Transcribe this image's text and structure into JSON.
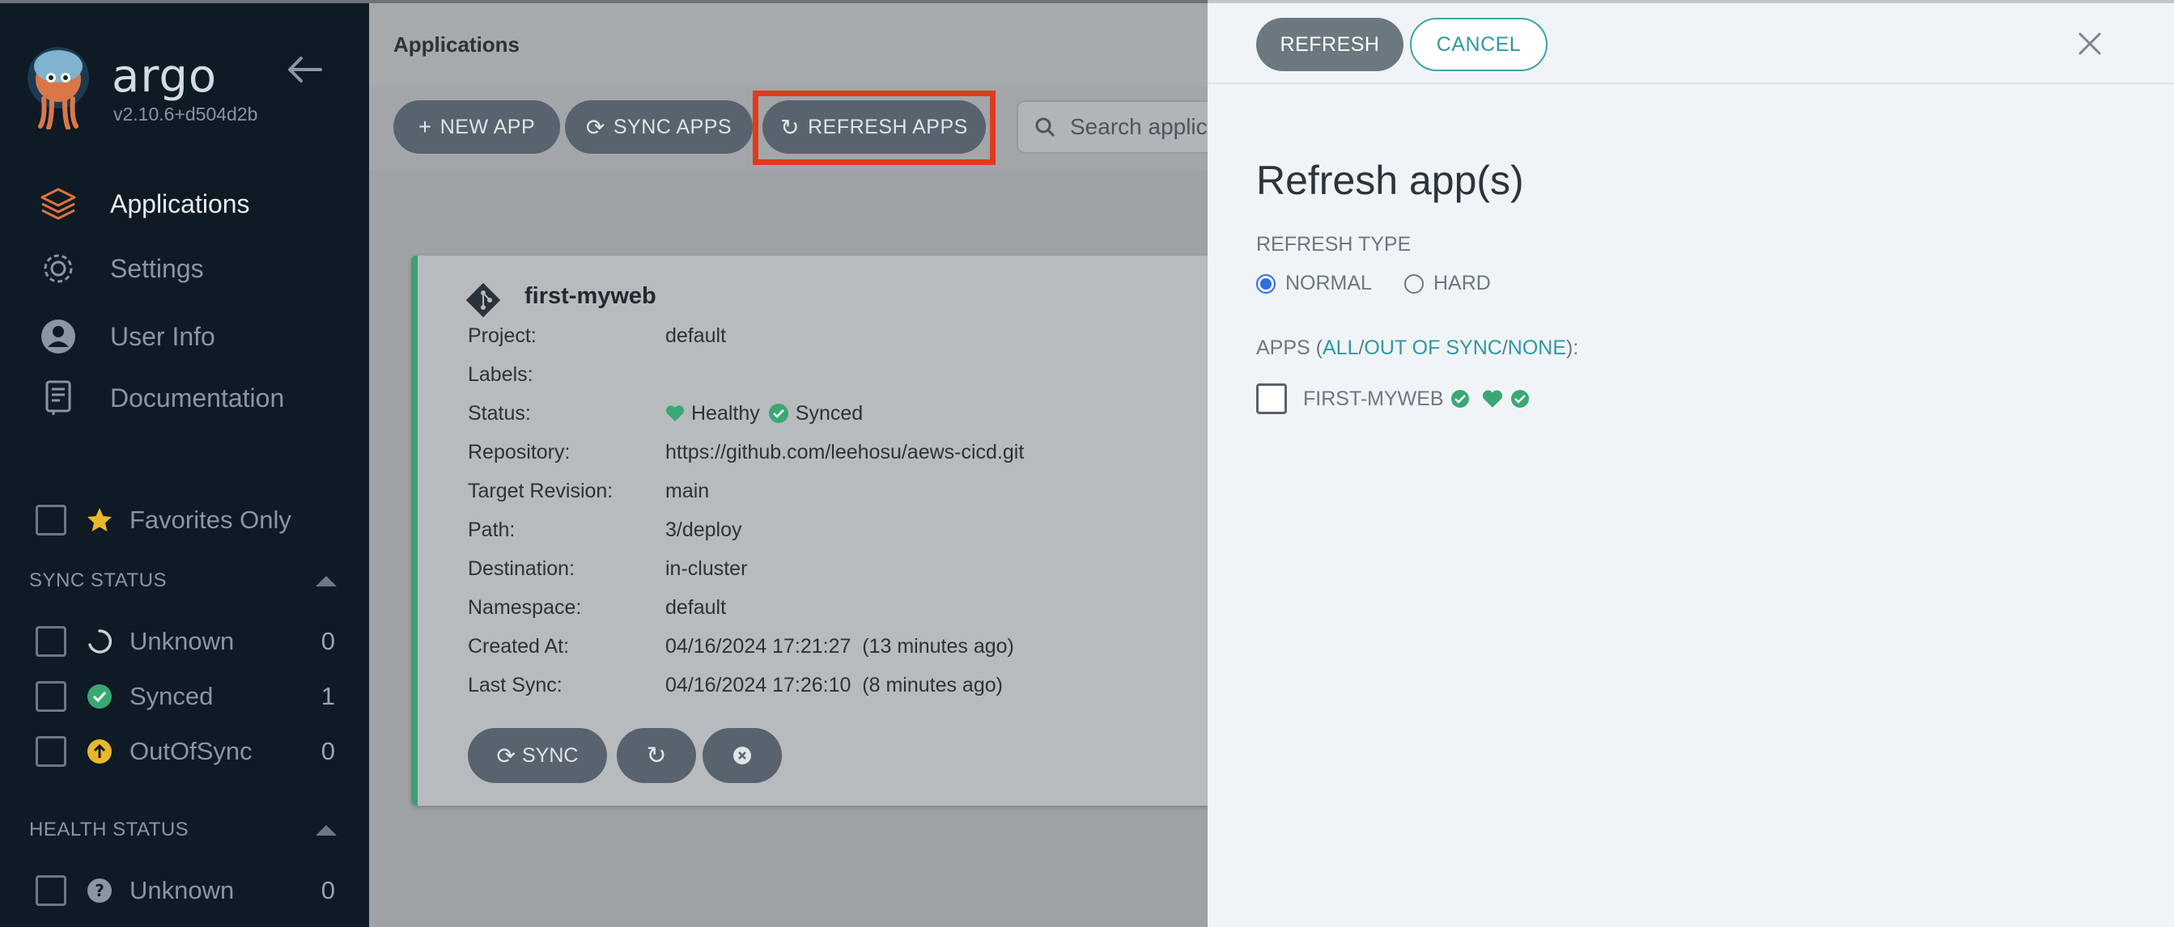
{
  "sidebar": {
    "brand": "argo",
    "version": "v2.10.6+d504d2b",
    "nav": [
      {
        "label": "Applications",
        "icon": "layers-icon",
        "active": true
      },
      {
        "label": "Settings",
        "icon": "gear-icon"
      },
      {
        "label": "User Info",
        "icon": "user-icon"
      },
      {
        "label": "Documentation",
        "icon": "book-icon"
      }
    ],
    "favorites_label": "Favorites Only",
    "sync_status_title": "SYNC STATUS",
    "sync_filters": [
      {
        "label": "Unknown",
        "count": "0"
      },
      {
        "label": "Synced",
        "count": "1"
      },
      {
        "label": "OutOfSync",
        "count": "0"
      }
    ],
    "health_status_title": "HEALTH STATUS",
    "health_filters": [
      {
        "label": "Unknown",
        "count": "0"
      }
    ]
  },
  "main": {
    "page_title": "Applications",
    "toolbar": {
      "new_app": "NEW APP",
      "sync_apps": "SYNC APPS",
      "refresh_apps": "REFRESH APPS",
      "search_placeholder": "Search applica"
    },
    "card": {
      "name": "first-myweb",
      "rows": [
        {
          "k": "Project:",
          "v": "default"
        },
        {
          "k": "Labels:",
          "v": ""
        },
        {
          "k": "Status:",
          "v": ""
        },
        {
          "k": "Repository:",
          "v": "https://github.com/leehosu/aews-cicd.git"
        },
        {
          "k": "Target Revision:",
          "v": "main"
        },
        {
          "k": "Path:",
          "v": "3/deploy"
        },
        {
          "k": "Destination:",
          "v": "in-cluster"
        },
        {
          "k": "Namespace:",
          "v": "default"
        },
        {
          "k": "Created At:",
          "v": "04/16/2024 17:21:27  (13 minutes ago)"
        },
        {
          "k": "Last Sync:",
          "v": "04/16/2024 17:26:10  (8 minutes ago)"
        }
      ],
      "health": "Healthy",
      "sync": "Synced",
      "sync_button": "SYNC"
    }
  },
  "panel": {
    "refresh_button": "REFRESH",
    "cancel_button": "CANCEL",
    "title": "Refresh app(s)",
    "refresh_type_label": "REFRESH TYPE",
    "normal_label": "NORMAL",
    "hard_label": "HARD",
    "apps_prefix": "APPS (",
    "apps_all": "ALL",
    "apps_out_of_sync": "OUT OF SYNC",
    "apps_none": "NONE",
    "apps_suffix": "):",
    "slash": "/",
    "app_name": "FIRST-MYWEB"
  },
  "colors": {
    "healthy": "#3aa873",
    "synced": "#3aa873",
    "outofsync": "#e8b72b",
    "accent": "#2f98a3",
    "highlight": "#e23a1c"
  }
}
